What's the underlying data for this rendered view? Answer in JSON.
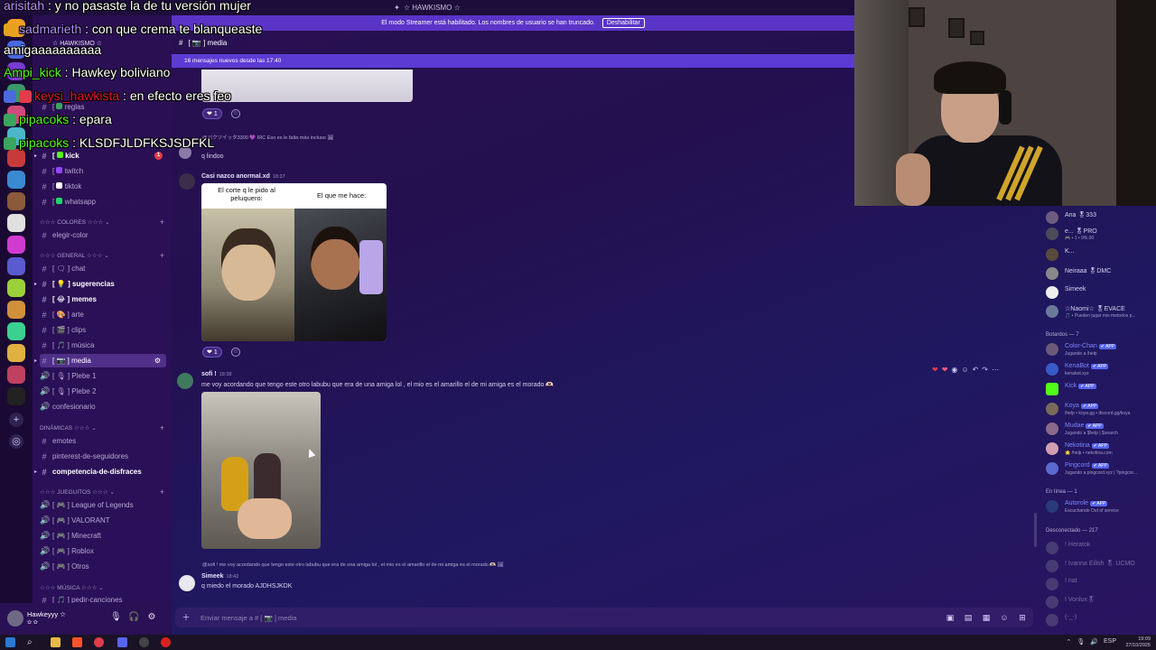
{
  "titlebar": {
    "server": "☆ HAWKISMO ☆"
  },
  "streamer_bar": {
    "text": "El modo Streamer está habilitado. Los nombres de usuario se han truncado.",
    "button": "Deshabilitar"
  },
  "sidebar": {
    "server_name": "☆ HAWKISMO ☆",
    "channels_top": [
      {
        "label": "reglas",
        "dot": "#3aa55d"
      },
      {
        "label": "kick",
        "dot": "#53fc18",
        "bold": true,
        "badge": "1"
      },
      {
        "label": "twitch",
        "dot": "#9147ff"
      },
      {
        "label": "tiktok",
        "dot": "#ffffff"
      },
      {
        "label": "whatsapp",
        "dot": "#25d366"
      }
    ],
    "cat_colores": "☆☆☆ COLORES ☆☆☆",
    "elegir_color": "elegir-color",
    "cat_general": "☆☆☆ GENERAL ☆☆☆",
    "general_channels": [
      {
        "label": "chat",
        "bracket": "[ ",
        "emoji": "🗨"
      },
      {
        "label": "sugerencias",
        "bracket": "[ ",
        "emoji": "💡",
        "bold": true
      },
      {
        "label": "memes",
        "bracket": "[ ",
        "emoji": "😂",
        "bold": true
      },
      {
        "label": "arte",
        "bracket": "[ ",
        "emoji": "🎨"
      },
      {
        "label": "clips",
        "bracket": "[ ",
        "emoji": "🎬"
      },
      {
        "label": "música",
        "bracket": "[ ",
        "emoji": "🎵"
      },
      {
        "label": "media",
        "bracket": "[ ",
        "emoji": "📷",
        "active": true
      },
      {
        "label": "Plebe 1",
        "bracket": "[ ",
        "emoji": "🎙",
        "voice": true
      },
      {
        "label": "Plebe 2",
        "bracket": "[ ",
        "emoji": "🎙",
        "voice": true
      },
      {
        "label": "confesionario",
        "voice": true
      }
    ],
    "cat_dinamicas": "DINÁMICAS ☆☆☆",
    "dinamicas_channels": [
      {
        "label": "emotes"
      },
      {
        "label": "pinterest-de-seguidores"
      },
      {
        "label": "competencia-de-disfraces",
        "bold": true
      }
    ],
    "cat_juegos": "☆☆☆ JUEGUITOS ☆☆☆",
    "juegos_channels": [
      {
        "label": "League of Legends",
        "bracket": "[ "
      },
      {
        "label": "VALORANT",
        "bracket": "[ "
      },
      {
        "label": "Minecraft",
        "bracket": "[ "
      },
      {
        "label": "Roblox",
        "bracket": "[ "
      },
      {
        "label": "Otros",
        "bracket": "[ "
      }
    ],
    "cat_musica": "☆☆☆ MÚSICA ☆☆☆",
    "musica_channels": [
      {
        "label": "pedir-canciones",
        "bracket": "[ "
      }
    ]
  },
  "user": {
    "name": "Hawkeyyy ☆",
    "status": "✿ ✿"
  },
  "chat": {
    "header": "[ 📷 ] media",
    "new_msgs": "16 mensajes nuevos desde las 17:40",
    "reply1": "@バクツイッタ3300 💜 IRC  Eso es le falta más incluso 🖼",
    "msg1_text": "q lindoo",
    "msg2_author": "Casi nazco anormal.xd",
    "msg2_time": "18:37",
    "meme_left": "El corte q le pido al peluquero:",
    "meme_right": "El que me hace:",
    "reaction_count": "1",
    "msg3_author": "sofi !",
    "msg3_time": "18:38",
    "msg3_text": "me voy acordando que tengo este otro labubu que era de una amiga lol , el mio es el amarillo el de mi amiga es el morado 🫶🏻",
    "reply2": "@sofi ! me voy acordando que tengo este otro labubu que era de una amiga lol , el mio es el amarillo el de mi amiga es el morado 🫶🏻 🖼",
    "msg4_author": "Simeek",
    "msg4_time": "18:42",
    "msg4_text": "q miedo el morado AJDHSJKDK",
    "input_placeholder": "Enviar mensaje a # [ 📷 ] media"
  },
  "members": {
    "top": [
      {
        "name": "Ana 🎖333",
        "sub": ""
      },
      {
        "name": "e... 🎖PRO",
        "sub": "🎮 • 1 • 9% 00"
      },
      {
        "name": "K...",
        "sub": ""
      },
      {
        "name": "Neiraaa 🎖DMC",
        "sub": ""
      },
      {
        "name": "Simeek",
        "sub": ""
      },
      {
        "name": "☆Naomi☆ 🎖EVACE",
        "sub": "🎵 • Pueden jugar mis metodos p..."
      }
    ],
    "cat_bots": "Botardos — 7",
    "bots": [
      {
        "name": "Color-Chan",
        "sub": "Jugando a /help",
        "color": "#7a87ff"
      },
      {
        "name": "KenaBot",
        "sub": "kenabot.xyz",
        "color": "#7a87ff"
      },
      {
        "name": "Kick",
        "sub": "",
        "color": "#7a87ff"
      },
      {
        "name": "Koya",
        "sub": "/help • koya.gg • discord.gg/koya",
        "color": "#7a87ff"
      },
      {
        "name": "Mudae",
        "sub": "Jugando a $help | $search",
        "color": "#7a87ff"
      },
      {
        "name": "Nekotina",
        "sub": "🌟 /help • nekotina.com",
        "color": "#7a87ff"
      },
      {
        "name": "Pingcord",
        "sub": "Jugando a pingcord.xyz | ?pingcor...",
        "color": "#7a87ff"
      }
    ],
    "app_tag": "✔ APP",
    "cat_online": "En línea — 1",
    "online": [
      {
        "name": "Autorole",
        "sub": "Escuchando Out of service"
      }
    ],
    "cat_offline": "Desconectado — 217",
    "offline": [
      "! Heratok",
      "! Ivanna Eilish 🎖 UCMO",
      "! nat",
      "! Vonlux🎖",
      "(-_-)"
    ]
  },
  "overlay": [
    {
      "nick": "arisitah",
      "color": "#c08dff",
      "text": " : y no pasaste la de tu versión mujer"
    },
    {
      "nick": "sadmarieth",
      "color": "#b28cff",
      "text": " : con que crema te blanqueaste"
    },
    {
      "nick": "",
      "color": "#ffffff",
      "text": "amigaaaaaaaaaa"
    },
    {
      "nick": "Ampi_kick",
      "color": "#53fc18",
      "text": " : Hawkey boliviano"
    },
    {
      "nick": "keysi_hawkista",
      "color": "#e3182d",
      "text": " : en efecto eres feo"
    },
    {
      "nick": "pipacoks",
      "color": "#53fc18",
      "text": " : epara"
    },
    {
      "nick": "pipacoks",
      "color": "#53fc18",
      "text": " : KLSDFJLDFKSJSDFKL"
    }
  ],
  "taskbar": {
    "time": "19:09",
    "date": "27/10/2025",
    "lang": "ESP"
  },
  "colors": {
    "accent": "#5865f2",
    "new_msgs": "#5c3bd4",
    "streamer": "#5a34c6"
  }
}
